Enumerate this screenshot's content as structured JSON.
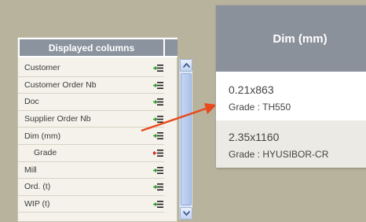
{
  "panel": {
    "title": "Displayed columns",
    "rows": [
      {
        "label": "Customer",
        "indent": false,
        "icon": "add-column-icon"
      },
      {
        "label": "Customer Order Nb",
        "indent": false,
        "icon": "add-column-icon"
      },
      {
        "label": "Doc",
        "indent": false,
        "icon": "add-column-icon"
      },
      {
        "label": "Supplier Order Nb",
        "indent": false,
        "icon": "add-column-icon"
      },
      {
        "label": "Dim (mm)",
        "indent": false,
        "icon": "add-column-icon"
      },
      {
        "label": "Grade",
        "indent": true,
        "icon": "remove-column-icon"
      },
      {
        "label": "Mill",
        "indent": false,
        "icon": "add-column-icon"
      },
      {
        "label": "Ord. (t)",
        "indent": false,
        "icon": "add-column-icon"
      },
      {
        "label": "WIP (t)",
        "indent": false,
        "icon": "add-column-icon"
      }
    ]
  },
  "zoom": {
    "header": "Dim (mm)",
    "rows": [
      {
        "dim": "0.21x863",
        "grade": "Grade : TH550"
      },
      {
        "dim": "2.35x1160",
        "grade": "Grade : HYUSIBOR-CR"
      }
    ]
  },
  "colors": {
    "arrow": "#e8491d",
    "add_arrow": "#2e9a2e",
    "remove_arrow": "#d42020",
    "header_bg": "#8b949e"
  }
}
